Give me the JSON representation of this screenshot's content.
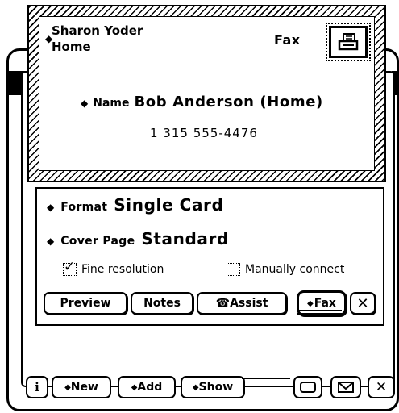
{
  "routing_slip": {
    "sender_name": "Sharon Yoder",
    "sender_location": "Home",
    "method": "Fax",
    "name_label": "Name",
    "recipient_name": "Bob Anderson (Home)",
    "recipient_phone": "1 315 555-4476",
    "stamp_icon": "fax-machine-icon"
  },
  "fax_options": {
    "format_label": "Format",
    "format_value": "Single Card",
    "cover_label": "Cover Page",
    "cover_value": "Standard",
    "fine_resolution_label": "Fine resolution",
    "fine_resolution_checked": true,
    "manual_connect_label": "Manually connect",
    "manual_connect_checked": false
  },
  "buttons": {
    "preview": "Preview",
    "notes": "Notes",
    "assist": "Assist",
    "assist_icon": "phone-icon",
    "fax": "Fax",
    "close_icon": "close-icon"
  },
  "bottom_bar": {
    "info_icon": "info-icon",
    "new": "New",
    "add": "Add",
    "show": "Show",
    "action_icons": [
      "routing-icon",
      "mail-icon",
      "close-icon"
    ]
  }
}
